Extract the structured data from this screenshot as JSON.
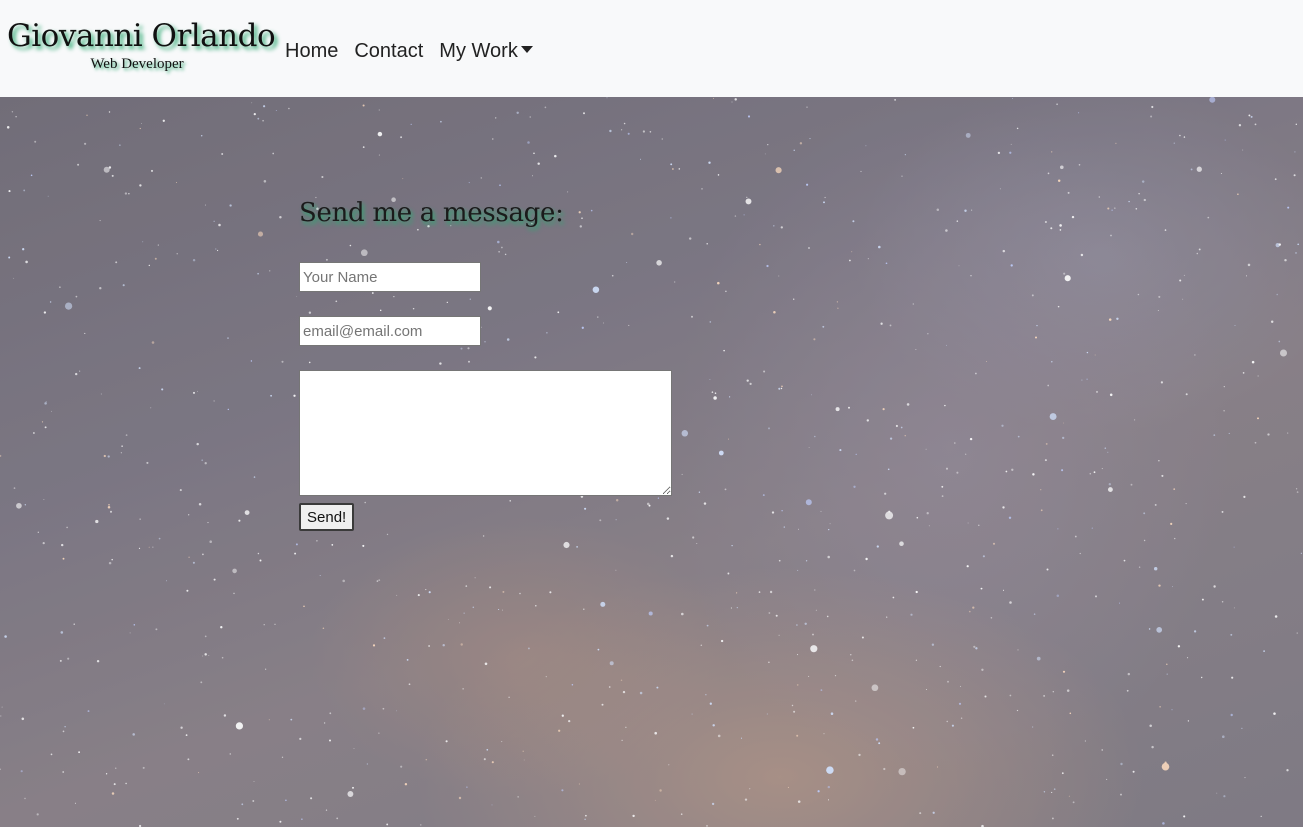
{
  "brand": {
    "name": "Giovanni Orlando",
    "subtitle": "Web Developer"
  },
  "nav": {
    "items": [
      {
        "label": "Home"
      },
      {
        "label": "Contact"
      },
      {
        "label": "My Work"
      }
    ],
    "dropdown_icon": "caret-down-icon"
  },
  "contact_form": {
    "title": "Send me a message:",
    "name_placeholder": "Your Name",
    "email_placeholder": "email@email.com",
    "message_value": "",
    "send_label": "Send!"
  },
  "colors": {
    "navbar_bg": "#f8f9fa",
    "text_shadow_accent": "#2ea872"
  }
}
